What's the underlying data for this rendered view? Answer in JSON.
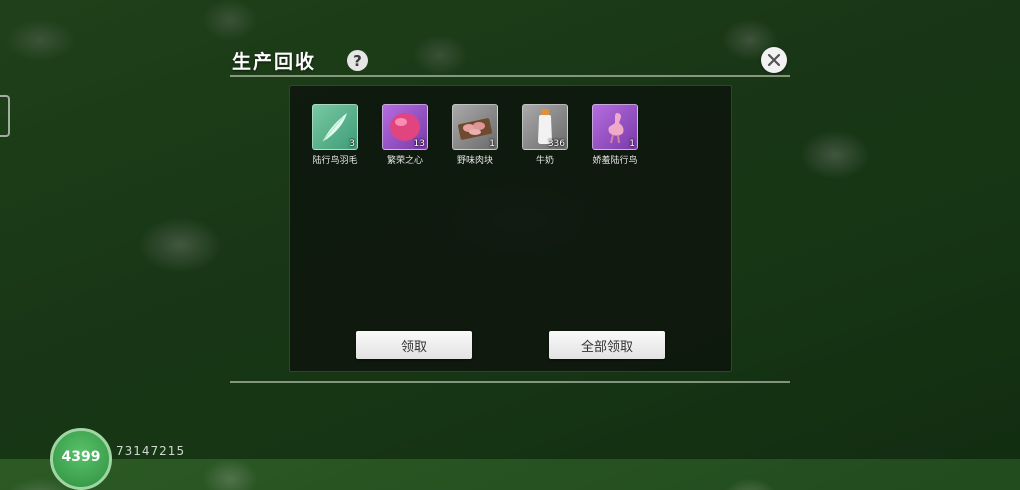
{
  "dialog": {
    "title": "生产回收",
    "help_icon": "question-mark-icon",
    "close_icon": "close-x-icon"
  },
  "items": [
    {
      "name": "陆行鸟羽毛",
      "count": "3",
      "icon": "feather-icon",
      "rarity_color": "#4fae83"
    },
    {
      "name": "繁荣之心",
      "count": "13",
      "icon": "pink-gem-icon",
      "rarity_color": "#9b4fce"
    },
    {
      "name": "野味肉块",
      "count": "1",
      "icon": "meat-tray-icon",
      "rarity_color": "#8a8a8a"
    },
    {
      "name": "牛奶",
      "count": "336",
      "icon": "milk-bottle-icon",
      "rarity_color": "#8a8a8a"
    },
    {
      "name": "娇羞陆行鸟",
      "count": "1",
      "icon": "pink-chocobo-icon",
      "rarity_color": "#9b4fce"
    }
  ],
  "buttons": {
    "claim": "领取",
    "claim_all": "全部领取"
  },
  "player": {
    "level": "4399",
    "id": "73147215"
  }
}
